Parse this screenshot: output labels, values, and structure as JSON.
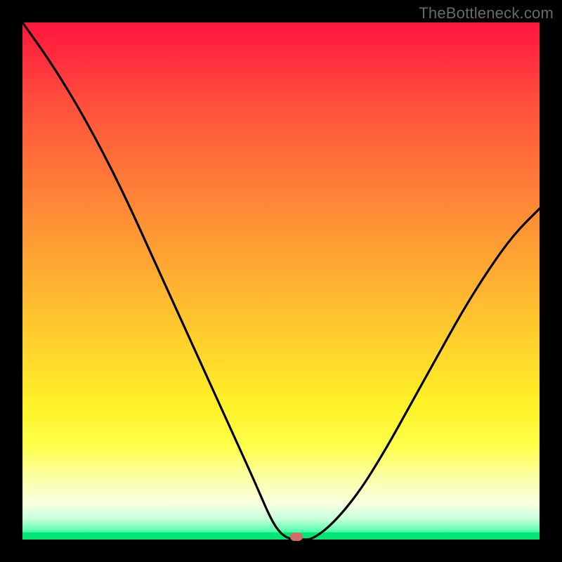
{
  "watermark": "TheBottleneck.com",
  "colors": {
    "frame": "#000000",
    "curve": "#000000",
    "marker": "#d36a63",
    "green": "#00e777"
  },
  "chart_data": {
    "type": "line",
    "title": "",
    "xlabel": "",
    "ylabel": "",
    "xlim": [
      0,
      100
    ],
    "ylim": [
      0,
      100
    ],
    "grid": false,
    "series": [
      {
        "name": "bottleneck-curve",
        "x": [
          0,
          5,
          10,
          15,
          20,
          25,
          30,
          35,
          40,
          45,
          48,
          50,
          52,
          54,
          56,
          60,
          65,
          70,
          75,
          80,
          85,
          90,
          95,
          100
        ],
        "y": [
          100,
          93,
          85,
          76,
          66,
          55,
          44,
          33,
          22,
          11,
          4,
          1,
          0,
          0,
          0,
          3,
          9,
          17,
          26,
          35,
          44,
          52,
          59,
          64
        ]
      }
    ],
    "annotations": [
      {
        "name": "current-point",
        "x": 53,
        "y": 0.5
      }
    ],
    "background_gradient": {
      "top": "#ff163f",
      "mid": "#fff227",
      "bottom": "#00e777"
    }
  }
}
